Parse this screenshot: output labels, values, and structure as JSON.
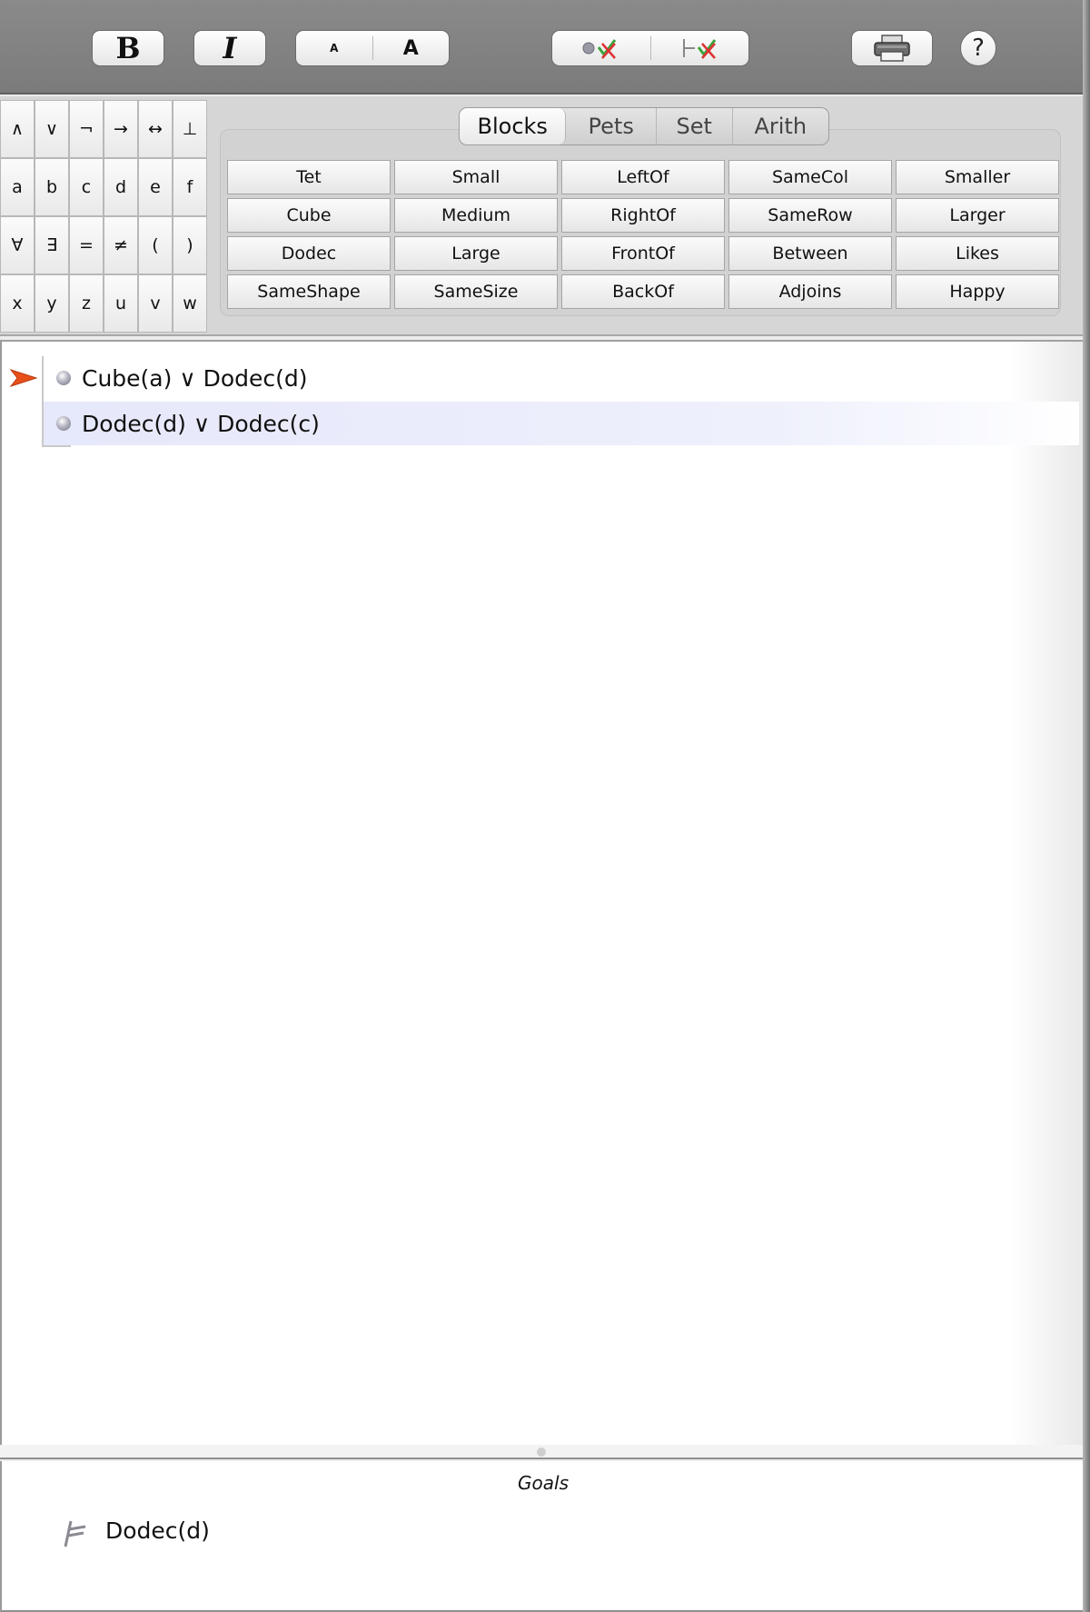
{
  "toolbar": {
    "bold_label": "B",
    "italic_label": "I",
    "font_smaller_label": "A",
    "font_larger_label": "A",
    "check_sentence_icon": "check-sentence-icon",
    "check_consequence_icon": "check-consequence-icon",
    "print_icon": "printer-icon",
    "help_label": "?"
  },
  "palette": {
    "symbols": [
      [
        "∧",
        "∨",
        "¬",
        "→",
        "↔",
        "⊥"
      ],
      [
        "a",
        "b",
        "c",
        "d",
        "e",
        "f"
      ],
      [
        "∀",
        "∃",
        "=",
        "≠",
        "(",
        ")"
      ],
      [
        "x",
        "y",
        "z",
        "u",
        "v",
        "w"
      ]
    ],
    "tabs": [
      "Blocks",
      "Pets",
      "Set",
      "Arith"
    ],
    "active_tab": "Blocks",
    "predicates": [
      [
        "Tet",
        "Small",
        "LeftOf",
        "SameCol",
        "Smaller"
      ],
      [
        "Cube",
        "Medium",
        "RightOf",
        "SameRow",
        "Larger"
      ],
      [
        "Dodec",
        "Large",
        "FrontOf",
        "Between",
        "Likes"
      ],
      [
        "SameShape",
        "SameSize",
        "BackOf",
        "Adjoins",
        "Happy"
      ]
    ]
  },
  "proof": {
    "premises": [
      "Cube(a) ∨ Dodec(d)",
      "Dodec(d) ∨ Dodec(c)"
    ],
    "selected_index": 1
  },
  "goals": {
    "title": "Goals",
    "items": [
      "Dodec(d)"
    ]
  },
  "colors": {
    "toolbar_bg": "#808080",
    "selection_bg": "#e6e8fb",
    "arrow": "#e8501a"
  }
}
